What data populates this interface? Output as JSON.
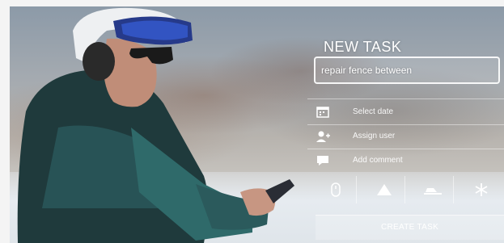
{
  "panel": {
    "title": "NEW TASK",
    "task_input_value": "repair fence between",
    "options": [
      {
        "label": "Select date",
        "icon": "calendar-icon"
      },
      {
        "label": "Assign user",
        "icon": "assign-user-icon"
      },
      {
        "label": "Add comment",
        "icon": "comment-icon"
      }
    ],
    "tools": [
      {
        "name": "mouse-icon"
      },
      {
        "name": "mountain-icon"
      },
      {
        "name": "snowcat-icon"
      },
      {
        "name": "snowflake-icon"
      }
    ],
    "create_label": "CREATE TASK"
  }
}
